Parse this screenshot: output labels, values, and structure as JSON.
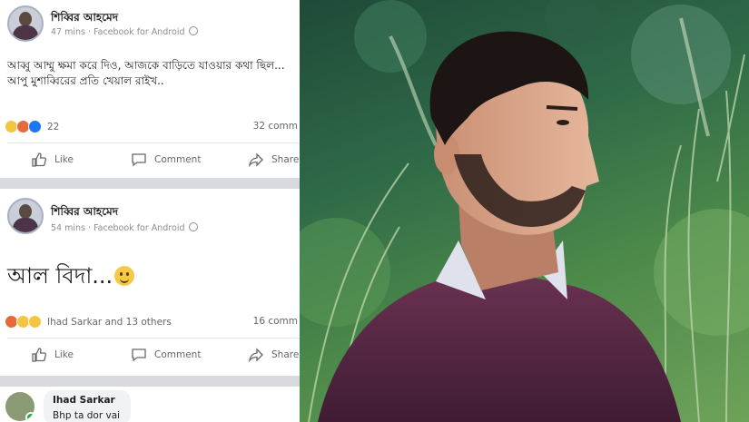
{
  "posts": [
    {
      "author": "শিব্বির আহমেদ",
      "time": "47 mins · Facebook for Android",
      "text_line1": "আব্বু আম্মু ক্ষমা করে দিও, আজকে বাড়িতে যাওয়ার কথা ছিল...",
      "text_line2": "আপু মুশাব্বিরের প্রতি খেয়াল রাইখ..",
      "reaction_count": "22",
      "comments": "32 comm",
      "like_label": "Like",
      "comment_label": "Comment",
      "share_label": "Share"
    },
    {
      "author": "শিব্বির আহমেদ",
      "time": "54 mins · Facebook for Android",
      "text": "আল বিদা...",
      "reaction_count": "Ihad Sarkar and 13 others",
      "comments": "16 comm",
      "like_label": "Like",
      "comment_label": "Comment",
      "share_label": "Share"
    }
  ],
  "comment": {
    "name": "Ihad Sarkar",
    "text": "Bhp ta dor vai"
  },
  "icons": [
    "like-icon",
    "comment-icon",
    "share-icon",
    "globe-icon",
    "smile-emoji-icon",
    "sad-reaction-icon",
    "angry-reaction-icon",
    "wow-reaction-icon"
  ],
  "colors": {
    "facebook_blue": "#1877f2",
    "separator": "#d9dadf"
  }
}
